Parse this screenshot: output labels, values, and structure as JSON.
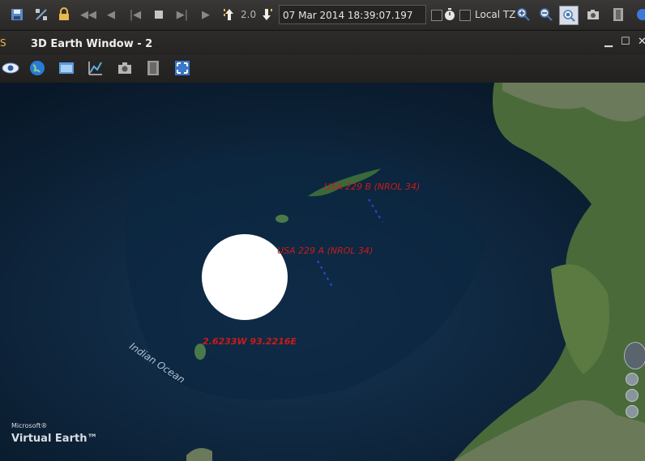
{
  "toolbar": {
    "speed_value": "2.0",
    "time_value": "07 Mar 2014 18:39:07.197 UTC",
    "local_tz_label": "Local TZ",
    "icons": [
      "save-icon",
      "satellite-tool-icon",
      "lock-icon",
      "rewind-icon",
      "step-back-icon",
      "reset-icon",
      "stop-icon",
      "step-forward-icon",
      "play-icon",
      "increase-speed-icon",
      "decrease-speed-icon",
      "realtime-icon",
      "zoom-in-icon",
      "zoom-out-icon",
      "zoom-to-icon",
      "snapshot-icon",
      "film-icon",
      "globe-icon"
    ]
  },
  "window": {
    "title": "3D Earth Window - 2",
    "sub_icons": [
      "eye-icon",
      "globe-icon",
      "folder-icon",
      "chart-icon",
      "camera-icon",
      "film-icon",
      "fullscreen-icon"
    ]
  },
  "map": {
    "ocean_label": "Indian Ocean",
    "satellites": [
      {
        "label": "USA 229 B (NROL 34)"
      },
      {
        "label": "USA 229 A (NROL 34)"
      }
    ],
    "coordinate_readout": "2.6233W 93.2216E",
    "watermark_ms": "Microsoft®",
    "watermark_ve": "Virtual Earth™",
    "colors": {
      "sat_label": "#cc1a1a",
      "ocean": "#0f2a45",
      "land": "#4a6a3a"
    }
  }
}
